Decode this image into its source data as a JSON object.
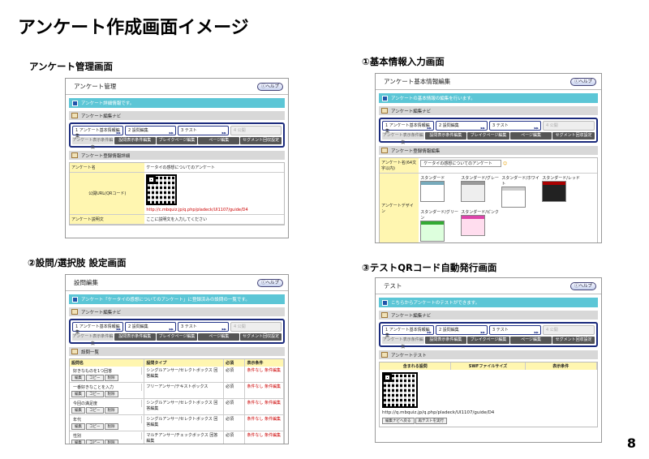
{
  "page_title": "アンケート作成画面イメージ",
  "page_number": "8",
  "captions": {
    "s1": "アンケート管理画面",
    "s2": "①基本情報入力画面",
    "s3": "②設問/選択肢 設定画面",
    "s4": "③テストQRコード自動発行画面"
  },
  "help": "ヘルプ",
  "nav_title": "アンケート編集ナビ",
  "steps": [
    "1 アンケート基本情報編集",
    "2 設問編集",
    "3 テスト",
    "4 公開"
  ],
  "tabs": [
    "アンケート表示条件編集",
    "設問表示条件編集",
    "ブレイクページ編集",
    "ページ編集",
    "セグメント回収設定"
  ],
  "s1": {
    "title": "アンケート管理",
    "info": "アンケート詳細情報です。",
    "detail_title": "アンケート登録情報詳細",
    "name_label": "アンケート名",
    "name_value": "ケータイの感想についてのアンケート",
    "url_label": "公開URL(QRコード)",
    "url_value": "http://c.mbquiz.jp/q.php/pladeck/UI1107/guide/D4",
    "desc_label": "アンケート説明文",
    "desc_value": "ここに説明文を入力してください"
  },
  "s2": {
    "title": "アンケート基本情報編集",
    "info": "アンケートの基本情報の編集を行います。",
    "reg_title": "アンケート登録情報編集",
    "name_label": "アンケート名(64文字以内)",
    "name_value": "ケータイの感想についてのアンケート",
    "design_label": "アンケートデザイン",
    "designs": [
      "スタンダード",
      "スタンダード/グレー",
      "スタンダード/ホワイト",
      "スタンダード/レッド",
      "スタンダード/グリーン",
      "スタンダード/ピンク"
    ]
  },
  "s3": {
    "title": "設問編集",
    "info": "アンケート「ケータイの感想についてのアンケート」に登録済みの設問の一覧です。",
    "list_title": "設問一覧",
    "cols": [
      "設問名",
      "設問タイプ",
      "必須",
      "表示条件"
    ],
    "rows": [
      {
        "name": "好きなものを1つ回答",
        "type": "シングルアンサー/セレクトボックス 回答編集",
        "req": "必須",
        "cond": "条件なし 条件編集"
      },
      {
        "name": "一番好きなことを入力",
        "type": "フリーアンサー/テキストボックス",
        "req": "必須",
        "cond": "条件なし 条件編集"
      },
      {
        "name": "今回の満足度",
        "type": "シングルアンサー/セレクトボックス 回答編集",
        "req": "必須",
        "cond": "条件なし 条件編集"
      },
      {
        "name": "年代",
        "type": "シングルアンサー/セレクトボックス 回答編集",
        "req": "必須",
        "cond": "条件なし 条件編集"
      },
      {
        "name": "性別",
        "type": "マルチアンサー/チェックボックス 回答編集",
        "req": "必須",
        "cond": "条件なし 条件編集"
      }
    ],
    "btns": [
      "編集",
      "コピー",
      "削除"
    ]
  },
  "s4": {
    "title": "テスト",
    "info": "こちらからアンケートのテストができます。",
    "test_title": "アンケートテスト",
    "cols": [
      "含まれる設問",
      "SWFファイルサイズ",
      "表示条件"
    ],
    "url": "http://q.mbquiz.jp/q.php/pladeck/UI1107/guide/D4",
    "btns": [
      "編集ナビへ戻る",
      "再テストを実行"
    ]
  }
}
